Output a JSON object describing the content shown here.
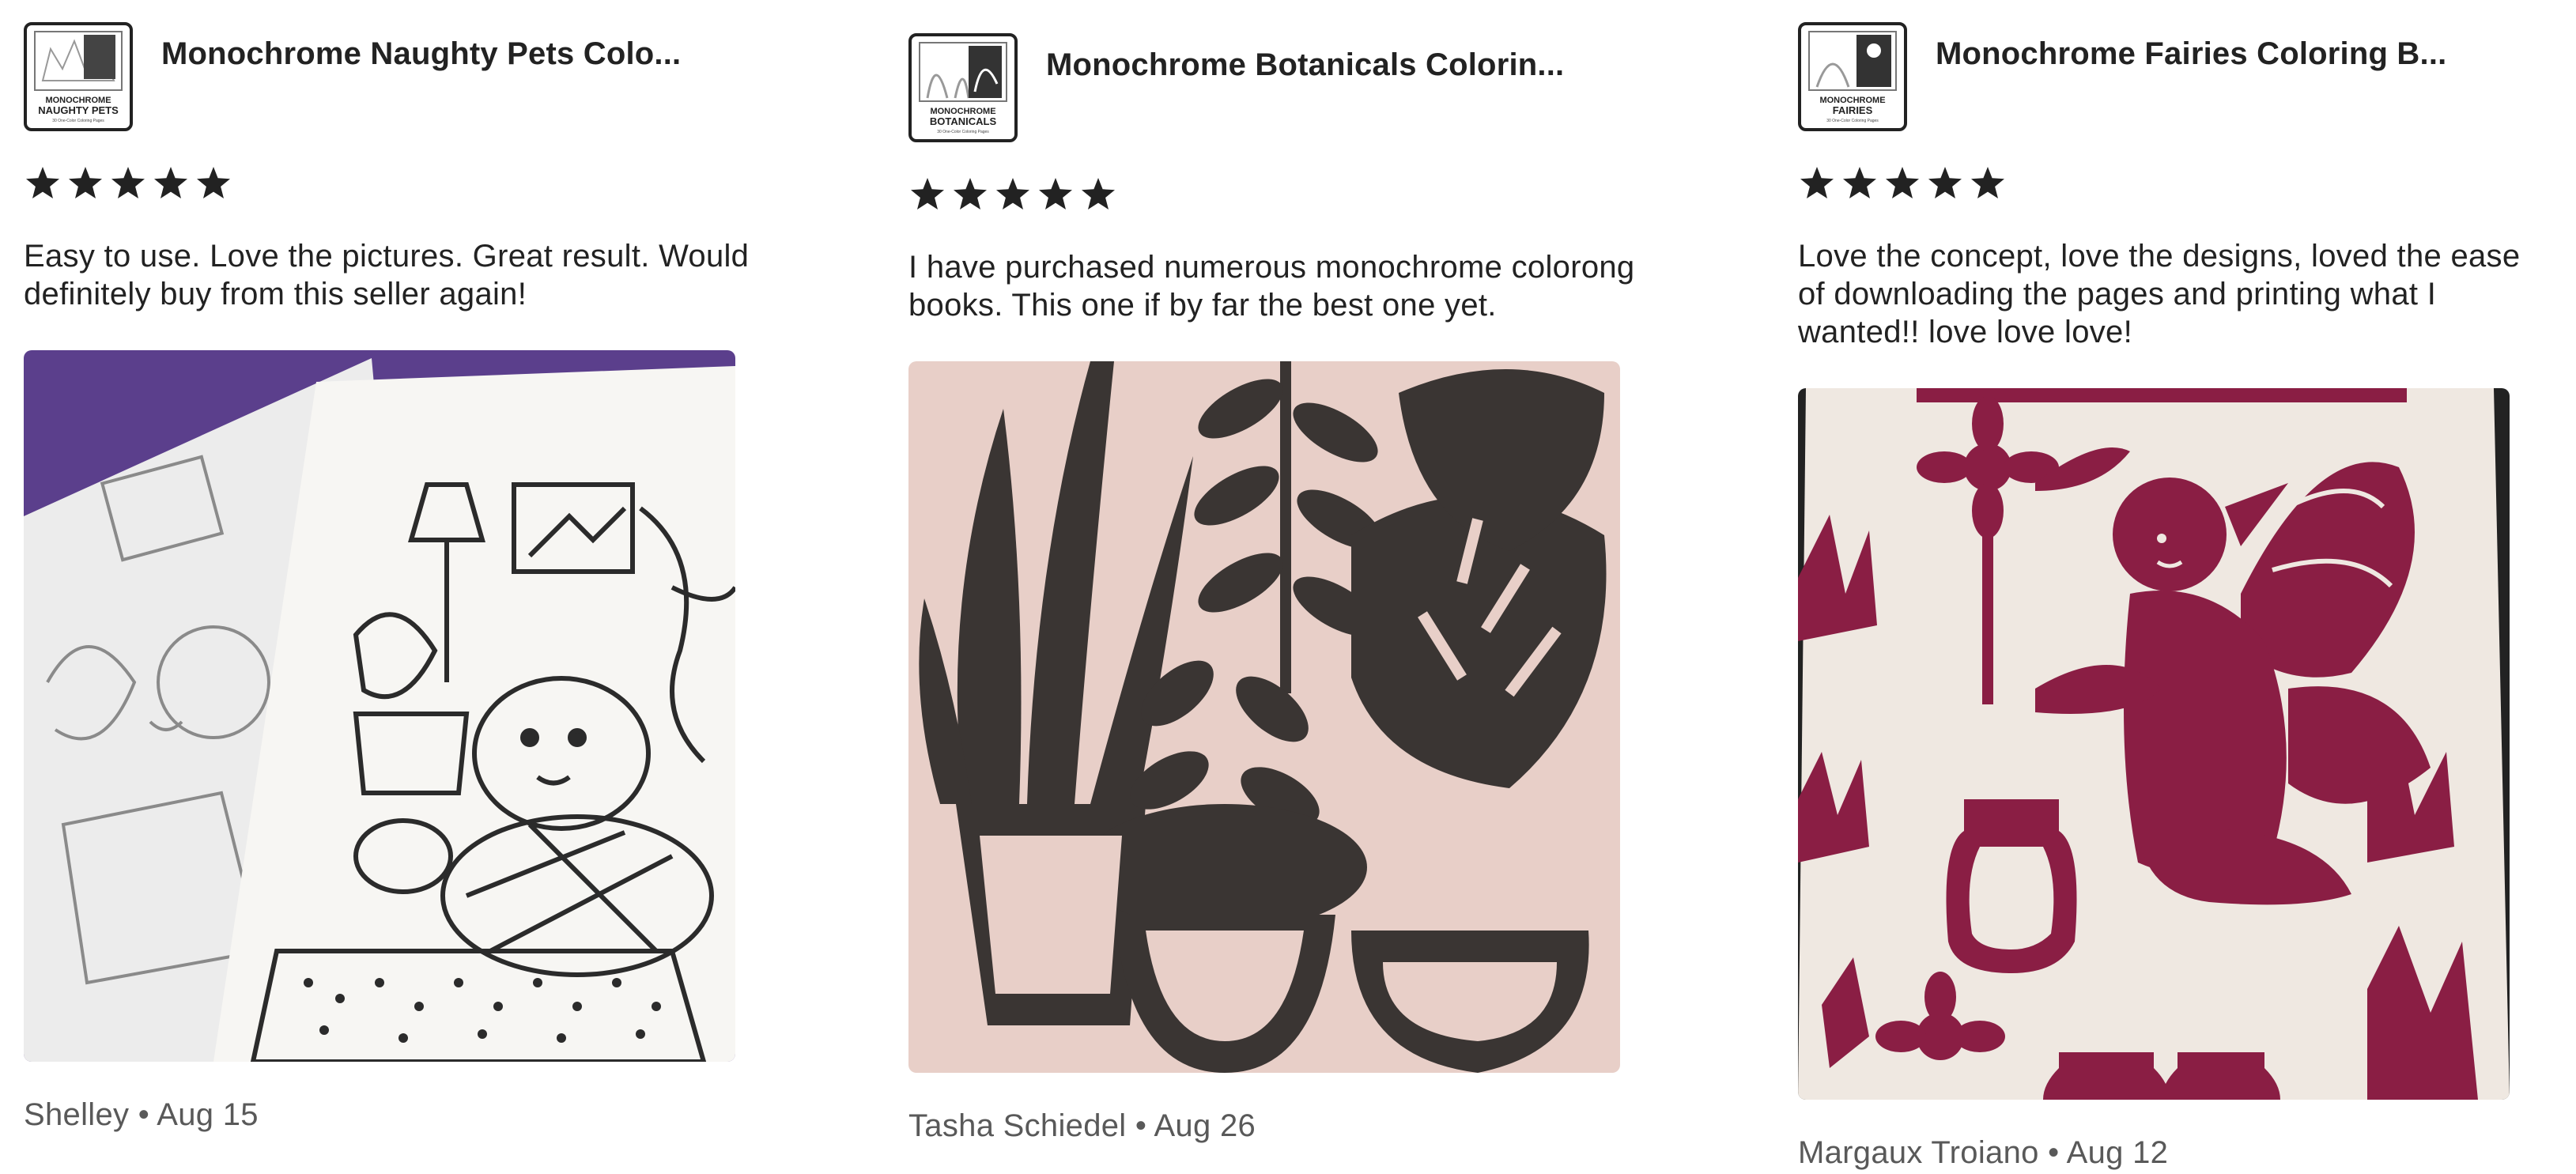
{
  "reviews": [
    {
      "product_title": "Monochrome Naughty Pets Colo...",
      "thumb_line1": "MONOCHROME",
      "thumb_line2": "NAUGHTY PETS",
      "thumb_line3": "30 One-Color Coloring Pages",
      "rating": 5,
      "text": "Easy to use. Love the pictures. Great result. Would\ndefinitely buy from this seller again!",
      "reviewer": "Shelley",
      "separator": "•",
      "date": "Aug 15",
      "photo_icon": "pets-coloring-photo"
    },
    {
      "product_title": "Monochrome Botanicals Colorin...",
      "thumb_line1": "MONOCHROME",
      "thumb_line2": "BOTANICALS",
      "thumb_line3": "30 One-Color Coloring Pages",
      "rating": 5,
      "text": "I have purchased numerous monochrome colorong\nbooks. This one if by far the best one yet.",
      "reviewer": "Tasha Schiedel",
      "separator": "•",
      "date": "Aug 26",
      "photo_icon": "botanicals-coloring-photo"
    },
    {
      "product_title": "Monochrome Fairies Coloring B...",
      "thumb_line1": "MONOCHROME",
      "thumb_line2": "FAIRIES",
      "thumb_line3": "30 One-Color Coloring Pages",
      "rating": 5,
      "text": "Love the concept, love the designs, loved the ease\nof downloading the pages and printing what I\nwanted!! love love love!",
      "reviewer": "Margaux Troiano",
      "separator": "•",
      "date": "Aug 12",
      "photo_icon": "fairies-coloring-photo"
    }
  ],
  "colors": {
    "text": "#222222",
    "meta": "#595959",
    "star": "#222222",
    "photo1_bg": "#5b3f8c",
    "photo2_bg": "#e8cfc8",
    "photo2_ink": "#3a3533",
    "photo3_ink": "#8a1e44"
  }
}
